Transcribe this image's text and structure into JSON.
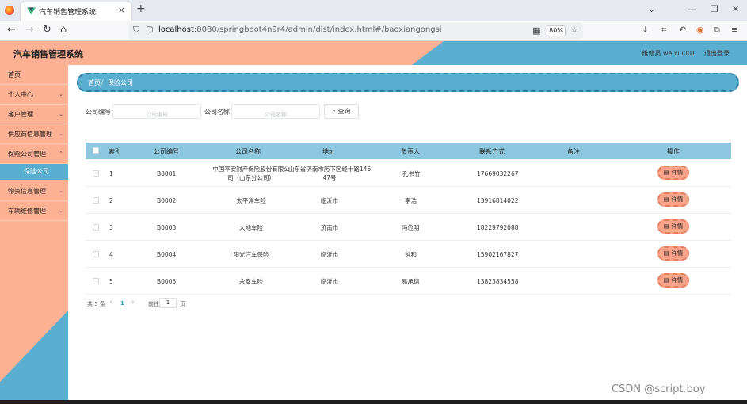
{
  "browser": {
    "tab_title": "汽车销售管理系统",
    "url_host": "localhost",
    "url_rest": ":8080/springboot4n9r4/admin/dist/index.html#/baoxiangongsi",
    "zoom": "80%"
  },
  "header": {
    "title": "汽车销售管理系统",
    "user": "维修员 weixiu001",
    "logout": "退出登录"
  },
  "sidebar": {
    "items": [
      {
        "label": "首页"
      },
      {
        "label": "个人中心"
      },
      {
        "label": "客户管理"
      },
      {
        "label": "供应商信息管理"
      },
      {
        "label": "保险公司管理"
      },
      {
        "label": "保险公司"
      },
      {
        "label": "物资信息管理"
      },
      {
        "label": "车辆维修管理"
      }
    ]
  },
  "breadcrumb": {
    "home": "首页",
    "sep": "/",
    "current": "保险公司"
  },
  "search": {
    "code_label": "公司编号",
    "code_placeholder": "公司编号",
    "name_label": "公司名称",
    "name_placeholder": "公司名称",
    "query_label": "查询"
  },
  "table": {
    "headers": {
      "index": "索引",
      "code": "公司编号",
      "name": "公司名称",
      "address": "地址",
      "person": "负责人",
      "contact": "联系方式",
      "remark": "备注",
      "action": "操作"
    },
    "rows": [
      {
        "index": "1",
        "code": "B0001",
        "name1": "中国平安财产保险股份有限公",
        "name2": "司（山东分公司）",
        "addr1": "山东省济南市历下区经十路146",
        "addr2": "47号",
        "person": "孔书竹",
        "contact": "17669032267",
        "remark": "",
        "action": "详情"
      },
      {
        "index": "2",
        "code": "B0002",
        "name1": "太平洋车险",
        "name2": "",
        "addr1": "临沂市",
        "addr2": "",
        "person": "李浩",
        "contact": "13916814022",
        "remark": "",
        "action": "详情"
      },
      {
        "index": "3",
        "code": "B0003",
        "name1": "大地车险",
        "name2": "",
        "addr1": "济南市",
        "addr2": "",
        "person": "冯俭明",
        "contact": "18229792088",
        "remark": "",
        "action": "详情"
      },
      {
        "index": "4",
        "code": "B0004",
        "name1": "阳光汽车保险",
        "name2": "",
        "addr1": "临沂市",
        "addr2": "",
        "person": "钟和",
        "contact": "15902167827",
        "remark": "",
        "action": "详情"
      },
      {
        "index": "5",
        "code": "B0005",
        "name1": "永安车险",
        "name2": "",
        "addr1": "临沂市",
        "addr2": "",
        "person": "易承德",
        "contact": "13823834558",
        "remark": "",
        "action": "详情"
      }
    ]
  },
  "pager": {
    "total": "共 5 条",
    "prev": "‹",
    "page": "1",
    "next": "›",
    "goto": "前往",
    "goto_value": "1",
    "unit": "页"
  },
  "watermark": "CSDN @script.boy"
}
